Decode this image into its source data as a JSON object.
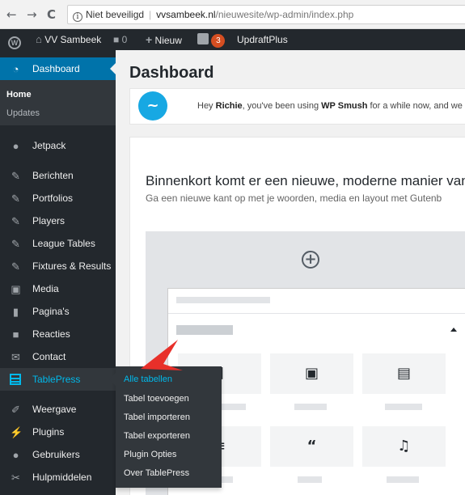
{
  "browser": {
    "back": "←",
    "forward": "→",
    "reload": "C",
    "security": "Niet beveiligd",
    "host": "vvsambeek.nl",
    "path": "/nieuwesite/wp-admin/index.php"
  },
  "adminbar": {
    "site_name": "VV Sambeek",
    "comments_count": "0",
    "new_label": "Nieuw",
    "yoast_count": "3",
    "plugin_label": "UpdraftPlus"
  },
  "sidebar": {
    "dashboard": "Dashboard",
    "sub_home": "Home",
    "sub_updates": "Updates",
    "jetpack": "Jetpack",
    "berichten": "Berichten",
    "portfolios": "Portfolios",
    "players": "Players",
    "league_tables": "League Tables",
    "fixtures": "Fixtures & Results",
    "media": "Media",
    "paginas": "Pagina's",
    "reacties": "Reacties",
    "contact": "Contact",
    "tablepress": "TablePress",
    "weergave": "Weergave",
    "plugins": "Plugins",
    "gebruikers": "Gebruikers",
    "hulpmiddelen": "Hulpmiddelen"
  },
  "flyout": {
    "items": [
      "Alle tabellen",
      "Tabel toevoegen",
      "Tabel importeren",
      "Tabel exporteren",
      "Plugin Opties",
      "Over TablePress"
    ]
  },
  "main": {
    "title": "Dashboard",
    "notice_prefix": "Hey ",
    "notice_name": "Richie",
    "notice_middle": ", you've been using ",
    "notice_plugin": "WP Smush",
    "notice_suffix": " for a while now, and we ho",
    "gutenberg_title": "Binnenkort komt er een nieuwe, moderne manier van",
    "gutenberg_sub": "Ga een nieuwe kant op met je woorden, media en layout met Gutenb"
  },
  "colors": {
    "admin_bar": "#23282d",
    "current_menu": "#0073aa",
    "tablepress_accent": "#00b9eb",
    "notification": "#d54e21",
    "arrow": "#e8302a"
  }
}
